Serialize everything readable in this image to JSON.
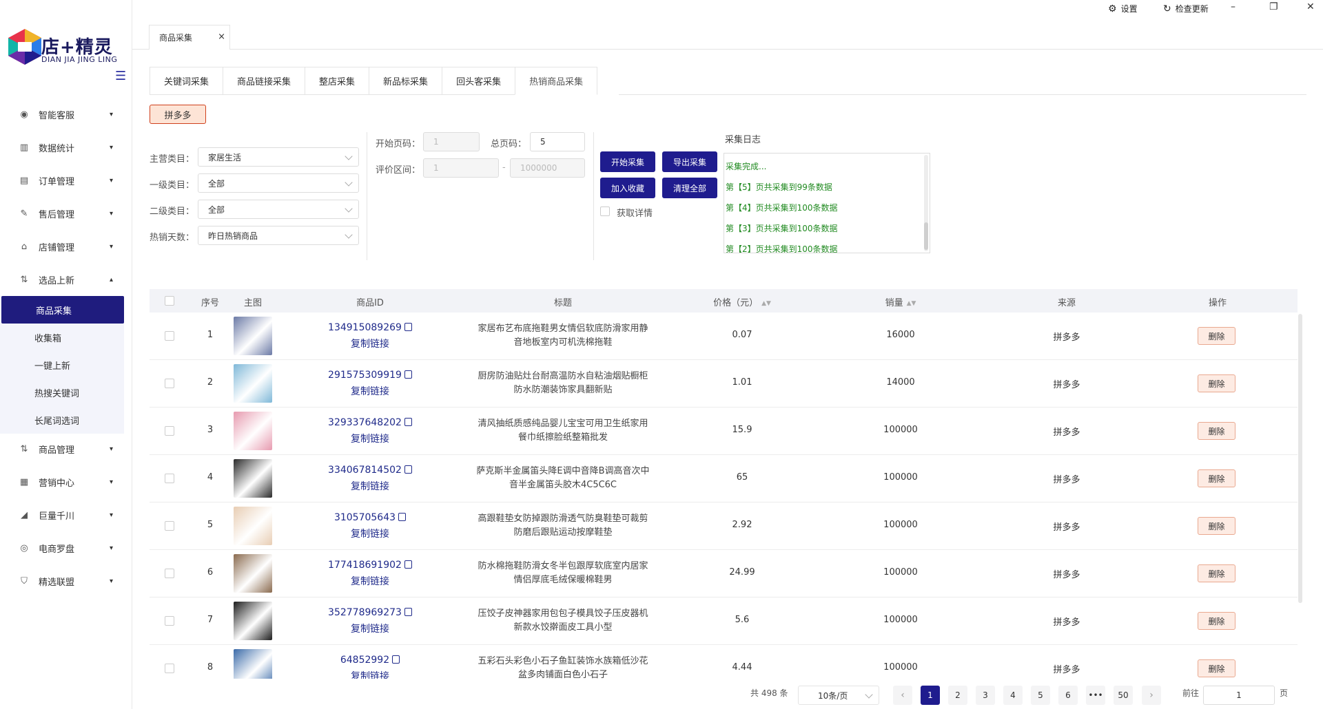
{
  "app": {
    "logo_title": "店+精灵",
    "logo_sub": "DIAN JIA JING LING"
  },
  "topbar": {
    "settings": "设置",
    "update": "检查更新",
    "minimize": "–",
    "restore": "❐",
    "close": "✕"
  },
  "page_tab": {
    "label": "商品采集",
    "close": "×"
  },
  "sidebar": {
    "items": [
      {
        "label": "智能客服",
        "icon": "robot-icon",
        "glyph": "◉",
        "chev": "▾"
      },
      {
        "label": "数据统计",
        "icon": "bar-chart-icon",
        "glyph": "▥",
        "chev": "▾"
      },
      {
        "label": "订单管理",
        "icon": "clipboard-icon",
        "glyph": "▤",
        "chev": "▾"
      },
      {
        "label": "售后管理",
        "icon": "edit-icon",
        "glyph": "✎",
        "chev": "▾"
      },
      {
        "label": "店铺管理",
        "icon": "store-icon",
        "glyph": "⌂",
        "chev": "▾"
      },
      {
        "label": "选品上新",
        "icon": "upload-icon",
        "glyph": "⇅",
        "chev": "▴"
      },
      {
        "label": "商品管理",
        "icon": "goods-icon",
        "glyph": "⇅",
        "chev": "▾"
      },
      {
        "label": "营销中心",
        "icon": "marketing-icon",
        "glyph": "▦",
        "chev": "▾"
      },
      {
        "label": "巨量千川",
        "icon": "signal-icon",
        "glyph": "◢",
        "chev": "▾"
      },
      {
        "label": "电商罗盘",
        "icon": "compass-icon",
        "glyph": "◎",
        "chev": "▾"
      },
      {
        "label": "精选联盟",
        "icon": "shield-icon",
        "glyph": "⛉",
        "chev": "▾"
      }
    ],
    "sub_items": [
      "商品采集",
      "收集箱",
      "一键上新",
      "热搜关键词",
      "长尾词选词"
    ]
  },
  "subtabs": [
    "关键词采集",
    "商品链接采集",
    "整店采集",
    "新品标采集",
    "回头客采集",
    "热销商品采集"
  ],
  "platform": "拼多多",
  "filters": {
    "main_cat_label": "主营类目：",
    "main_cat_value": "家居生活",
    "cat1_label": "一级类目：",
    "cat1_value": "全部",
    "cat2_label": "二级类目：",
    "cat2_value": "全部",
    "days_label": "热销天数：",
    "days_value": "昨日热销商品",
    "start_page_label": "开始页码：",
    "start_page_value": "1",
    "total_page_label": "总页码：",
    "total_page_value": "5",
    "review_label": "评价区间：",
    "review_min": "1",
    "review_sep": "-",
    "review_max": "1000000"
  },
  "actions": {
    "start": "开始采集",
    "export": "导出采集",
    "favorite": "加入收藏",
    "clear": "清理全部",
    "detail": "获取详情"
  },
  "log": {
    "title": "采集日志",
    "lines": [
      "采集完成...",
      "第【5】页共采集到99条数据",
      "第【4】页共采集到100条数据",
      "第【3】页共采集到100条数据",
      "第【2】页共采集到100条数据"
    ]
  },
  "table": {
    "headers": {
      "index": "序号",
      "image": "主图",
      "id": "商品ID",
      "title": "标题",
      "price": "价格（元）",
      "sales": "销量",
      "source": "来源",
      "action": "操作"
    },
    "copy_label": "复制链接",
    "delete_label": "删除",
    "rows": [
      {
        "index": "1",
        "id": "134915089269",
        "title1": "家居布艺布底拖鞋男女情侣软底防滑家用静",
        "title2": "音地板室内可机洗棉拖鞋",
        "price": "0.07",
        "sales": "16000",
        "source": "拼多多",
        "thumb": "#6b7aa6"
      },
      {
        "index": "2",
        "id": "291575309919",
        "title1": "厨房防油贴灶台耐高温防水自粘油烟贴橱柜",
        "title2": "防水防潮装饰家具翻新贴",
        "price": "1.01",
        "sales": "14000",
        "source": "拼多多",
        "thumb": "#7fb8d8"
      },
      {
        "index": "3",
        "id": "329337648202",
        "title1": "清风抽纸质感纯品婴儿宝宝可用卫生纸家用",
        "title2": "餐巾纸擦脸纸整箱批发",
        "price": "15.9",
        "sales": "100000",
        "source": "拼多多",
        "thumb": "#e79aaf"
      },
      {
        "index": "4",
        "id": "334067814502",
        "title1": "萨克斯半金属笛头降E调中音降B调高音次中",
        "title2": "音半金属笛头胶木4C5C6C",
        "price": "65",
        "sales": "100000",
        "source": "拼多多",
        "thumb": "#2a2a2a"
      },
      {
        "index": "5",
        "id": "3105705643",
        "title1": "高跟鞋垫女防掉跟防滑透气防臭鞋垫可裁剪",
        "title2": "防磨后跟贴运动按摩鞋垫",
        "price": "2.92",
        "sales": "100000",
        "source": "拼多多",
        "thumb": "#e8cdb3"
      },
      {
        "index": "6",
        "id": "177418691902",
        "title1": "防水棉拖鞋防滑女冬半包跟厚软底室内居家",
        "title2": "情侣厚底毛绒保暖棉鞋男",
        "price": "24.99",
        "sales": "100000",
        "source": "拼多多",
        "thumb": "#8a6a4e"
      },
      {
        "index": "7",
        "id": "352778969273",
        "title1": "压饺子皮神器家用包包子模具饺子压皮器机",
        "title2": "新款水饺擀面皮工具小型",
        "price": "5.6",
        "sales": "100000",
        "source": "拼多多",
        "thumb": "#1c1c1c"
      },
      {
        "index": "8",
        "id": "64852992",
        "title1": "五彩石头彩色小石子鱼缸装饰水族箱低沙花",
        "title2": "盆多肉铺面白色小石子",
        "price": "4.44",
        "sales": "100000",
        "source": "拼多多",
        "thumb": "#3a6aa8"
      }
    ]
  },
  "pagination": {
    "total": "共 498 条",
    "page_size": "10条/页",
    "pages": [
      "1",
      "2",
      "3",
      "4",
      "5",
      "6",
      "•••",
      "50"
    ],
    "goto_label": "前往",
    "goto_value": "1",
    "goto_unit": "页"
  },
  "colors": {
    "primary": "#1f1c8e",
    "log_green": "#228b22",
    "platform_border": "#cf3f1b"
  }
}
